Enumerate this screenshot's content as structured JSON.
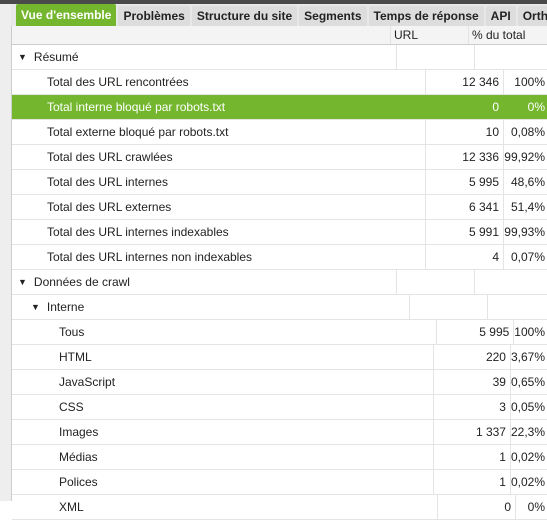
{
  "tabs": [
    "Vue d'ensemble",
    "Problèmes",
    "Structure du site",
    "Segments",
    "Temps de réponse",
    "API",
    "Ortho"
  ],
  "columns": {
    "url": "URL",
    "pct": "% du total"
  },
  "accent": "#74b72e",
  "rows": [
    {
      "label": "Résumé",
      "url": "",
      "pct": "",
      "level": 0,
      "group": true
    },
    {
      "label": "Total des URL rencontrées",
      "url": "12 346",
      "pct": "100%",
      "level": 1
    },
    {
      "label": "Total interne bloqué par robots.txt",
      "url": "0",
      "pct": "0%",
      "level": 1,
      "selected": true
    },
    {
      "label": "Total externe bloqué par robots.txt",
      "url": "10",
      "pct": "0,08%",
      "level": 1
    },
    {
      "label": "Total des URL crawlées",
      "url": "12 336",
      "pct": "99,92%",
      "level": 1
    },
    {
      "label": "Total des URL internes",
      "url": "5 995",
      "pct": "48,6%",
      "level": 1
    },
    {
      "label": "Total des URL externes",
      "url": "6 341",
      "pct": "51,4%",
      "level": 1
    },
    {
      "label": "Total des URL internes indexables",
      "url": "5 991",
      "pct": "99,93%",
      "level": 1
    },
    {
      "label": "Total des URL internes non indexables",
      "url": "4",
      "pct": "0,07%",
      "level": 1
    },
    {
      "label": "Données de crawl",
      "url": "",
      "pct": "",
      "level": 0,
      "group": true
    },
    {
      "label": "Interne",
      "url": "",
      "pct": "",
      "level": 1,
      "group": true
    },
    {
      "label": "Tous",
      "url": "5 995",
      "pct": "100%",
      "level": 2
    },
    {
      "label": "HTML",
      "url": "220",
      "pct": "3,67%",
      "level": 2
    },
    {
      "label": "JavaScript",
      "url": "39",
      "pct": "0,65%",
      "level": 2
    },
    {
      "label": "CSS",
      "url": "3",
      "pct": "0,05%",
      "level": 2
    },
    {
      "label": "Images",
      "url": "1 337",
      "pct": "22,3%",
      "level": 2
    },
    {
      "label": "Médias",
      "url": "1",
      "pct": "0,02%",
      "level": 2
    },
    {
      "label": "Polices",
      "url": "1",
      "pct": "0,02%",
      "level": 2
    },
    {
      "label": "XML",
      "url": "0",
      "pct": "0%",
      "level": 2
    }
  ]
}
